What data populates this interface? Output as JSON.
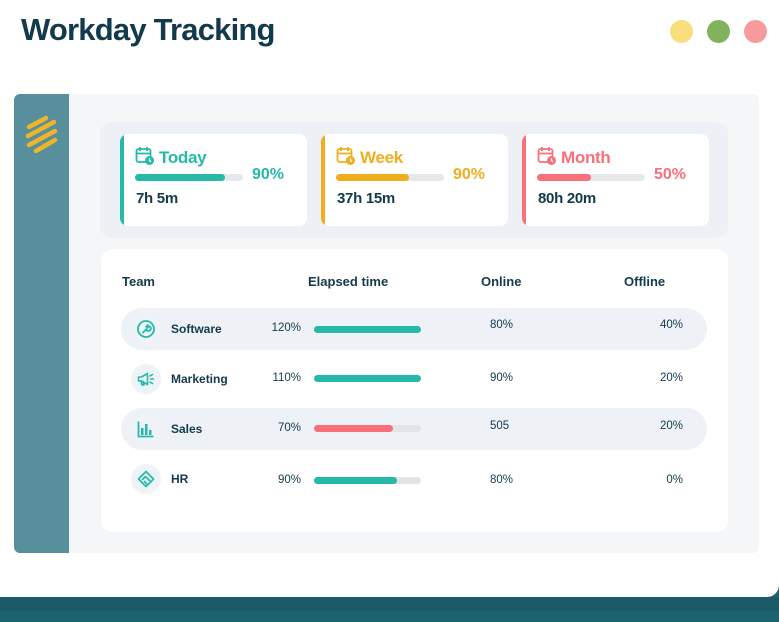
{
  "app": {
    "title": "Workday Tracking"
  },
  "colors": {
    "teal": "#26b9a8",
    "yellow": "#f0ae1e",
    "red": "#f7707a",
    "navy": "#133a4c",
    "sidebar": "#578f9c"
  },
  "window_controls": [
    {
      "name": "minimize",
      "color": "#f8df7b"
    },
    {
      "name": "maximize",
      "color": "#82b25c"
    },
    {
      "name": "close",
      "color": "#f69a9b"
    }
  ],
  "cards": [
    {
      "title": "Today",
      "percent_label": "90%",
      "progress": 0.83,
      "hours": "7h 5m",
      "color": "#26b9a8",
      "icon": "calendar-clock-icon"
    },
    {
      "title": "Week",
      "percent_label": "90%",
      "progress": 0.68,
      "hours": "37h 15m",
      "color": "#f0ae1e",
      "icon": "calendar-clock-icon"
    },
    {
      "title": "Month",
      "percent_label": "50%",
      "progress": 0.5,
      "hours": "80h 20m",
      "color": "#f7707a",
      "icon": "calendar-clock-icon"
    }
  ],
  "table": {
    "headers": {
      "team": "Team",
      "elapsed": "Elapsed time",
      "online": "Online",
      "offline": "Offline"
    },
    "rows": [
      {
        "team": "Software",
        "icon": "wrench-icon",
        "elapsed": "120%",
        "progress": 1.0,
        "bar_color": "#26b9a8",
        "online": "80%",
        "offline": "40%"
      },
      {
        "team": "Marketing",
        "icon": "megaphone-icon",
        "elapsed": "110%",
        "progress": 1.0,
        "bar_color": "#26b9a8",
        "online": "90%",
        "offline": "20%"
      },
      {
        "team": "Sales",
        "icon": "bar-chart-icon",
        "elapsed": "70%",
        "progress": 0.74,
        "bar_color": "#f7707a",
        "online": "505",
        "offline": "20%"
      },
      {
        "team": "HR",
        "icon": "handshake-icon",
        "elapsed": "90%",
        "progress": 0.78,
        "bar_color": "#26b9a8",
        "online": "80%",
        "offline": "0%"
      }
    ]
  }
}
